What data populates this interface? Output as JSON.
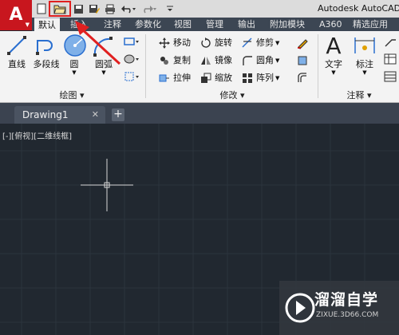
{
  "title_bar": {
    "app_logo": "A",
    "app_title": "Autodesk AutoCAD",
    "qat_icons": [
      "new-icon",
      "open-icon",
      "save-icon",
      "save-as-icon",
      "print-icon",
      "undo-icon",
      "redo-icon"
    ]
  },
  "ribbon_tabs": [
    "默认",
    "插入",
    "注释",
    "参数化",
    "视图",
    "管理",
    "输出",
    "附加模块",
    "A360",
    "精选应用"
  ],
  "active_tab": "默认",
  "panels": {
    "draw": {
      "title": "绘图 ▾",
      "tools": [
        "直线",
        "多段线",
        "圆",
        "圆弧"
      ]
    },
    "modify": {
      "title": "修改 ▾",
      "tools": [
        "移动",
        "旋转",
        "修剪",
        "复制",
        "镜像",
        "圆角",
        "拉伸",
        "缩放",
        "阵列"
      ]
    },
    "annotate": {
      "title": "注释 ▾",
      "tools": [
        "文字",
        "标注"
      ]
    }
  },
  "file_tab": {
    "label": "Drawing1",
    "close": "✕",
    "new_tab": "+"
  },
  "viewport_label": "[-][俯视][二维线框]",
  "watermark": {
    "text": "溜溜自学",
    "url": "ZIXUE.3D66.COM"
  },
  "colors": {
    "logo_red": "#c8161e",
    "highlight_red": "#e02020",
    "canvas": "#212830",
    "grid": "#2c343d",
    "ribbon_bg": "#f3f3f3",
    "tab_bar": "#3c4653"
  }
}
